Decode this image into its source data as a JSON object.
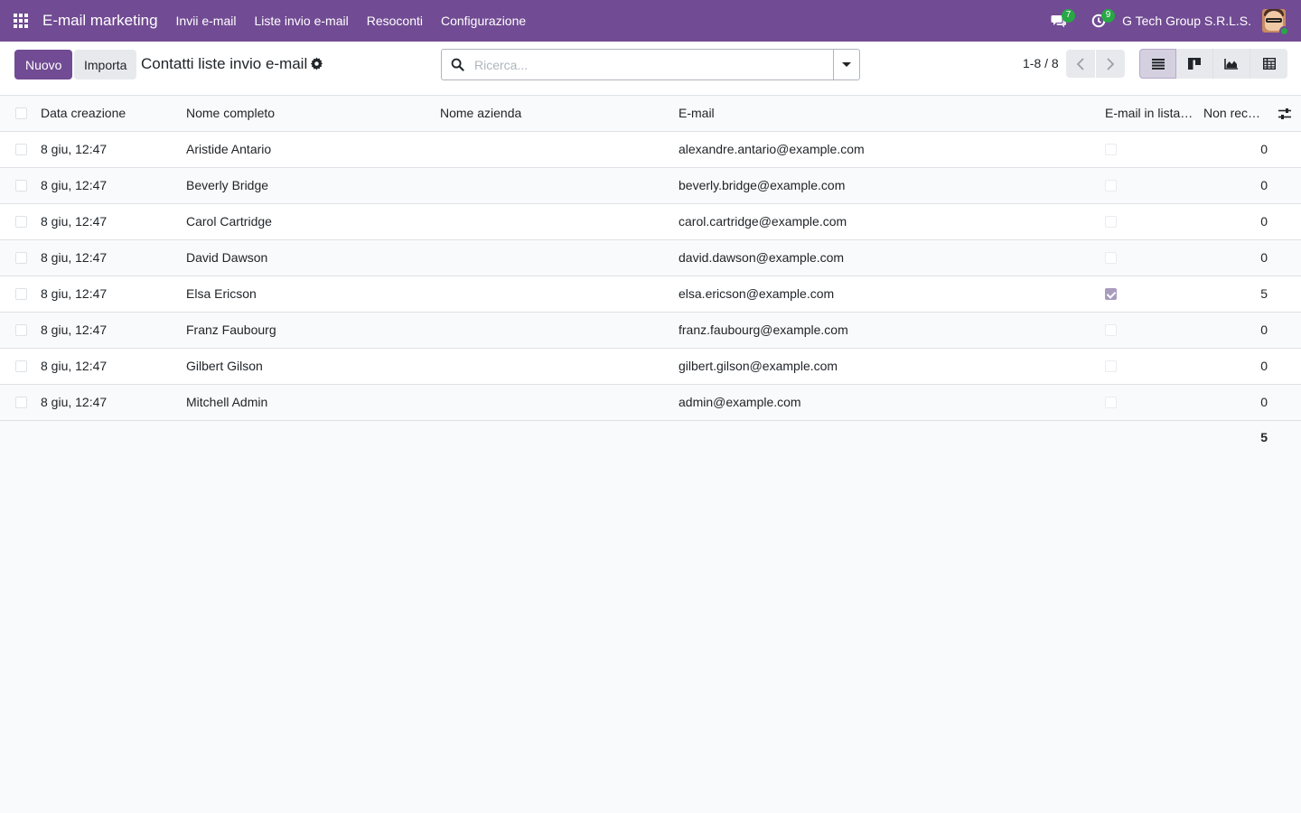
{
  "navbar": {
    "app_name": "E-mail marketing",
    "menu": [
      "Invii e-mail",
      "Liste invio e-mail",
      "Resoconti",
      "Configurazione"
    ],
    "messages_count": "7",
    "activities_count": "9",
    "company": "G Tech Group S.R.L.S.",
    "accent_color": "#714b93"
  },
  "control_panel": {
    "new_label": "Nuovo",
    "import_label": "Importa",
    "title": "Contatti liste invio e-mail",
    "search_placeholder": "Ricerca...",
    "pager": "1-8 / 8",
    "views": [
      "list-icon",
      "kanban-icon",
      "graph-icon",
      "pivot-icon"
    ],
    "active_view": "list"
  },
  "table": {
    "columns": [
      "Data creazione",
      "Nome completo",
      "Nome azienda",
      "E-mail",
      "E-mail in lista…",
      "Non rec…"
    ],
    "rows": [
      {
        "date": "8 giu, 12:47",
        "name": "Aristide Antario",
        "company": "",
        "email": "alexandre.antario@example.com",
        "opt_in": false,
        "bounce": "0"
      },
      {
        "date": "8 giu, 12:47",
        "name": "Beverly Bridge",
        "company": "",
        "email": "beverly.bridge@example.com",
        "opt_in": false,
        "bounce": "0"
      },
      {
        "date": "8 giu, 12:47",
        "name": "Carol Cartridge",
        "company": "",
        "email": "carol.cartridge@example.com",
        "opt_in": false,
        "bounce": "0"
      },
      {
        "date": "8 giu, 12:47",
        "name": "David Dawson",
        "company": "",
        "email": "david.dawson@example.com",
        "opt_in": false,
        "bounce": "0"
      },
      {
        "date": "8 giu, 12:47",
        "name": "Elsa Ericson",
        "company": "",
        "email": "elsa.ericson@example.com",
        "opt_in": true,
        "bounce": "5"
      },
      {
        "date": "8 giu, 12:47",
        "name": "Franz Faubourg",
        "company": "",
        "email": "franz.faubourg@example.com",
        "opt_in": false,
        "bounce": "0"
      },
      {
        "date": "8 giu, 12:47",
        "name": "Gilbert Gilson",
        "company": "",
        "email": "gilbert.gilson@example.com",
        "opt_in": false,
        "bounce": "0"
      },
      {
        "date": "8 giu, 12:47",
        "name": "Mitchell Admin",
        "company": "",
        "email": "admin@example.com",
        "opt_in": false,
        "bounce": "0"
      }
    ],
    "bounce_total": "5"
  }
}
